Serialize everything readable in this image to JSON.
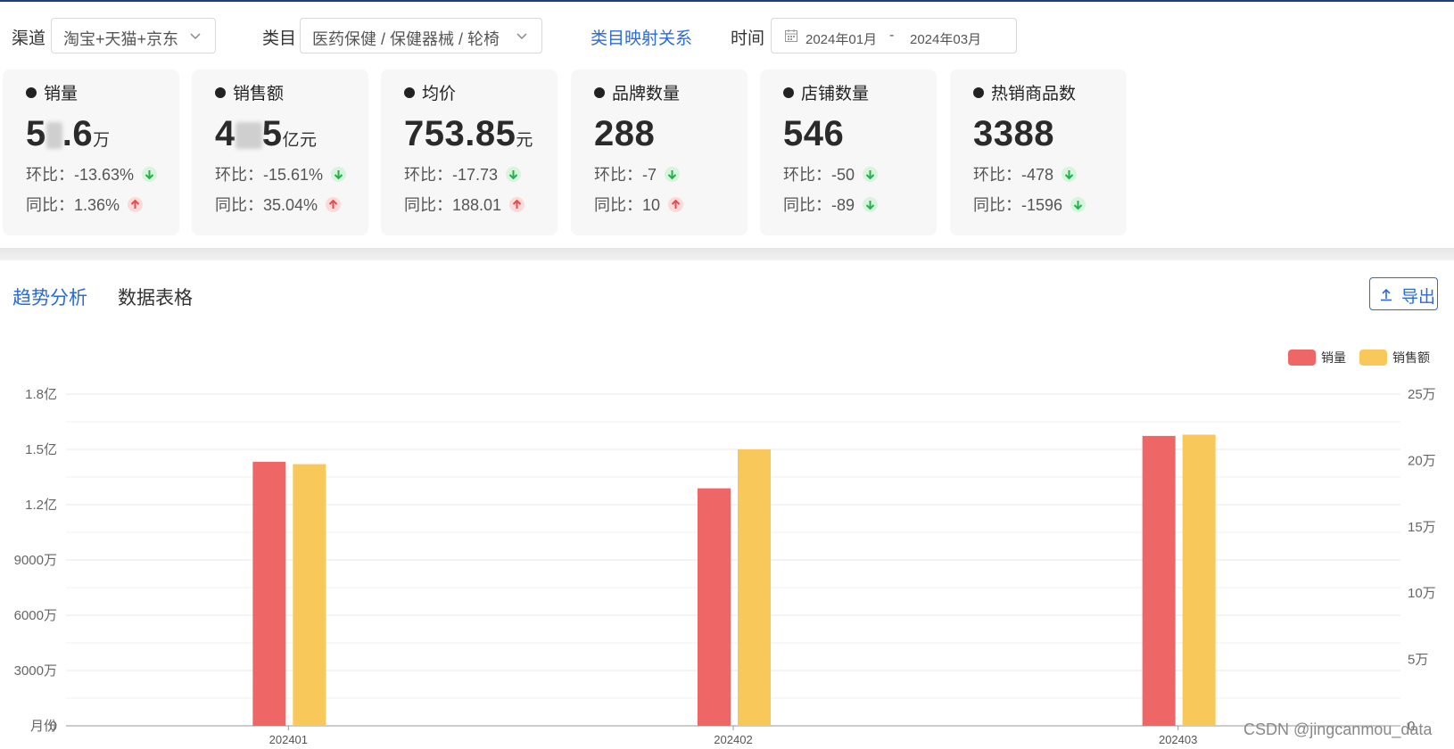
{
  "filters": {
    "channel_label": "渠道",
    "channel_value": "淘宝+天猫+京东",
    "category_label": "类目",
    "category_value": "医药保健 / 保健器械 / 轮椅",
    "mapping_link": "类目映射关系",
    "time_label": "时间",
    "date_start": "2024年01月",
    "date_sep": "-",
    "date_end": "2024年03月"
  },
  "kpis": [
    {
      "title": "销量",
      "prefix": "5",
      "suffix": ".6",
      "unit": "万",
      "mom": "环比：-13.63%",
      "mom_dir": "down",
      "yoy": "同比：1.36%",
      "yoy_dir": "up"
    },
    {
      "title": "销售额",
      "prefix": "4",
      "suffix": "5",
      "unit": "亿元",
      "mom": "环比：-15.61%",
      "mom_dir": "down",
      "yoy": "同比：35.04%",
      "yoy_dir": "up"
    },
    {
      "title": "均价",
      "value": "753.85",
      "unit": "元",
      "mom": "环比：-17.73",
      "mom_dir": "down",
      "yoy": "同比：188.01",
      "yoy_dir": "up"
    },
    {
      "title": "品牌数量",
      "value": "288",
      "unit": "",
      "mom": "环比：-7",
      "mom_dir": "down",
      "yoy": "同比：10",
      "yoy_dir": "up"
    },
    {
      "title": "店铺数量",
      "value": "546",
      "unit": "",
      "mom": "环比：-50",
      "mom_dir": "down",
      "yoy": "同比：-89",
      "yoy_dir": "down"
    },
    {
      "title": "热销商品数",
      "value": "3388",
      "unit": "",
      "mom": "环比：-478",
      "mom_dir": "down",
      "yoy": "同比：-1596",
      "yoy_dir": "down"
    }
  ],
  "tabs": {
    "trend": "趋势分析",
    "table": "数据表格"
  },
  "export_label": "导出",
  "watermark": "CSDN @jingcanmou_data",
  "colors": {
    "sales_volume": "#ef6666",
    "sales_amount": "#f9c85a",
    "accent": "#2b6ad9",
    "down": "#22b14c",
    "up": "#e84b4b"
  },
  "chart_data": {
    "type": "bar",
    "xlabel": "月份",
    "categories": [
      "202401",
      "202402",
      "202403"
    ],
    "series": [
      {
        "name": "销量",
        "axis": "right",
        "values": [
          199000,
          179000,
          218500
        ]
      },
      {
        "name": "销售额",
        "axis": "left",
        "values": [
          142000000,
          150000000,
          158000000
        ]
      }
    ],
    "left_axis": {
      "ticks": [
        "0",
        "3000万",
        "6000万",
        "9000万",
        "1.2亿",
        "1.5亿",
        "1.8亿"
      ],
      "ylim": [
        0,
        180000000
      ]
    },
    "right_axis": {
      "ticks": [
        "0",
        "5万",
        "10万",
        "15万",
        "20万",
        "25万"
      ],
      "ylim": [
        0,
        250000
      ]
    },
    "legend": "top-right",
    "grid": true
  }
}
